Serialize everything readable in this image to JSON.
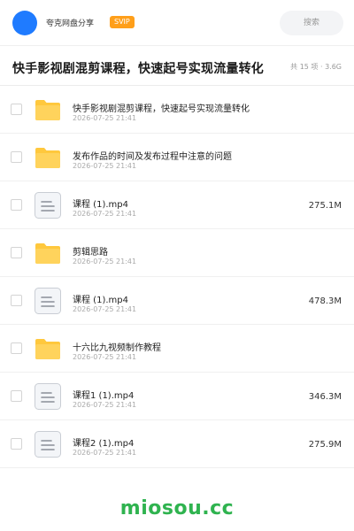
{
  "header": {
    "share_name": "夸克网盘分享",
    "vip_badge": "SVIP",
    "search_placeholder": "搜索"
  },
  "page": {
    "title": "快手影视剧混剪课程，快速起号实现流量转化",
    "meta": "共 15 项 · 3.6G"
  },
  "files": [
    {
      "type": "folder-icon",
      "name": "快手影视剧混剪课程，快速起号实现流量转化",
      "date": "2026-07-25 21:41",
      "size": ""
    },
    {
      "type": "folder-icon",
      "name": "发布作品的时间及发布过程中注意的问题",
      "date": "2026-07-25 21:41",
      "size": ""
    },
    {
      "type": "file-icon",
      "name": "课程 (1).mp4",
      "date": "2026-07-25 21:41",
      "size": "275.1M"
    },
    {
      "type": "folder-icon",
      "name": "剪辑思路",
      "date": "2026-07-25 21:41",
      "size": ""
    },
    {
      "type": "file-icon",
      "name": "课程 (1).mp4",
      "date": "2026-07-25 21:41",
      "size": "478.3M"
    },
    {
      "type": "folder-icon",
      "name": "十六比九视频制作教程",
      "date": "2026-07-25 21:41",
      "size": ""
    },
    {
      "type": "file-icon",
      "name": "课程1 (1).mp4",
      "date": "2026-07-25 21:41",
      "size": "346.3M"
    },
    {
      "type": "file-icon",
      "name": "课程2 (1).mp4",
      "date": "2026-07-25 21:41",
      "size": "275.9M"
    }
  ],
  "watermark": "miosou.cc",
  "colors": {
    "avatar": "#1f7bff",
    "vip": "#ff9f1a",
    "folder": "#ffc83d",
    "watermark": "#2fb34f"
  }
}
